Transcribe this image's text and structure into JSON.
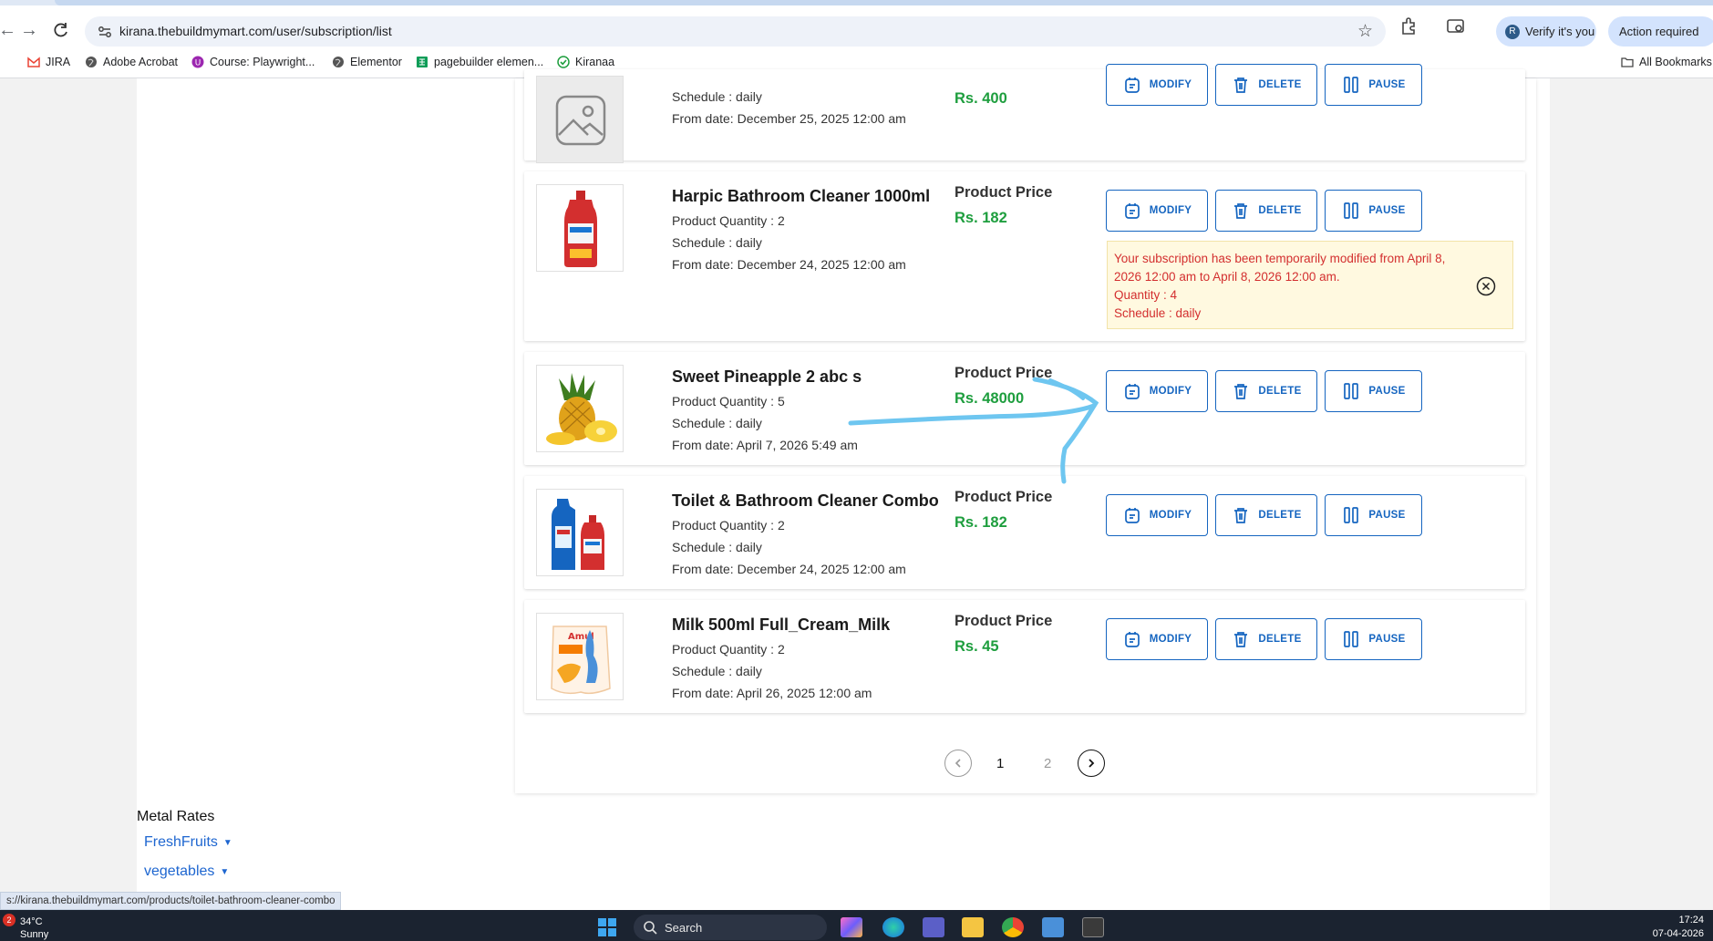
{
  "browser": {
    "url": "kirana.thebuildmymart.com/user/subscription/list",
    "verify_label": "Verify it's you",
    "verify_avatar": "R",
    "action_label": "Action required",
    "bookmarks": [
      {
        "label": "JIRA",
        "icon": "gmail-icon"
      },
      {
        "label": "Adobe Acrobat",
        "icon": "globe-icon"
      },
      {
        "label": "Course: Playwright...",
        "icon": "course-icon"
      },
      {
        "label": "Elementor",
        "icon": "globe-icon"
      },
      {
        "label": "pagebuilder elemen...",
        "icon": "sheets-icon"
      },
      {
        "label": "Kiranaa",
        "icon": "check-icon"
      }
    ],
    "all_bookmarks": "All Bookmarks",
    "status_url": "s://kirana.thebuildmymart.com/products/toilet-bathroom-cleaner-combo"
  },
  "subscriptions": [
    {
      "name": "",
      "quantity": "",
      "schedule": "Schedule : daily",
      "from": "From date: December 25, 2025 12:00 am",
      "price_label": "",
      "price": "Rs. 400"
    },
    {
      "name": "Harpic Bathroom Cleaner 1000ml",
      "quantity": "Product Quantity : 2",
      "schedule": "Schedule : daily",
      "from": "From date: December 24, 2025 12:00 am",
      "price_label": "Product Price",
      "price": "Rs. 182"
    },
    {
      "name": "Sweet Pineapple 2 abc s",
      "quantity": "Product Quantity : 5",
      "schedule": "Schedule : daily",
      "from": "From date: April 7, 2026 5:49 am",
      "price_label": "Product Price",
      "price": "Rs. 48000"
    },
    {
      "name": "Toilet & Bathroom Cleaner Combo",
      "quantity": "Product Quantity : 2",
      "schedule": "Schedule : daily",
      "from": "From date: December 24, 2025 12:00 am",
      "price_label": "Product Price",
      "price": "Rs. 182"
    },
    {
      "name": "Milk 500ml Full_Cream_Milk",
      "quantity": "Product Quantity : 2",
      "schedule": "Schedule : daily",
      "from": "From date: April 26, 2025 12:00 am",
      "price_label": "Product Price",
      "price": "Rs. 45"
    }
  ],
  "buttons": {
    "modify": "MODIFY",
    "delete": "DELETE",
    "pause": "PAUSE"
  },
  "notice": {
    "line1": "Your subscription has been temporarily modified from April 8,",
    "line2": "2026 12:00 am to April 8, 2026 12:00 am.",
    "line3": "Quantity : 4",
    "line4": "Schedule : daily"
  },
  "pagination": {
    "current": "1",
    "next": "2"
  },
  "footer": {
    "metal_rates": "Metal Rates",
    "links": [
      "FreshFruits",
      "vegetables"
    ]
  },
  "taskbar": {
    "weather_badge": "2",
    "temperature": "34°C",
    "weather": "Sunny",
    "search": "Search",
    "time": "17:24",
    "date": "07-04-2026"
  },
  "colors": {
    "accent": "#1565c0",
    "price": "#1e9e3e",
    "notice_text": "#d32f2f",
    "annotation": "#6ec6f0"
  }
}
